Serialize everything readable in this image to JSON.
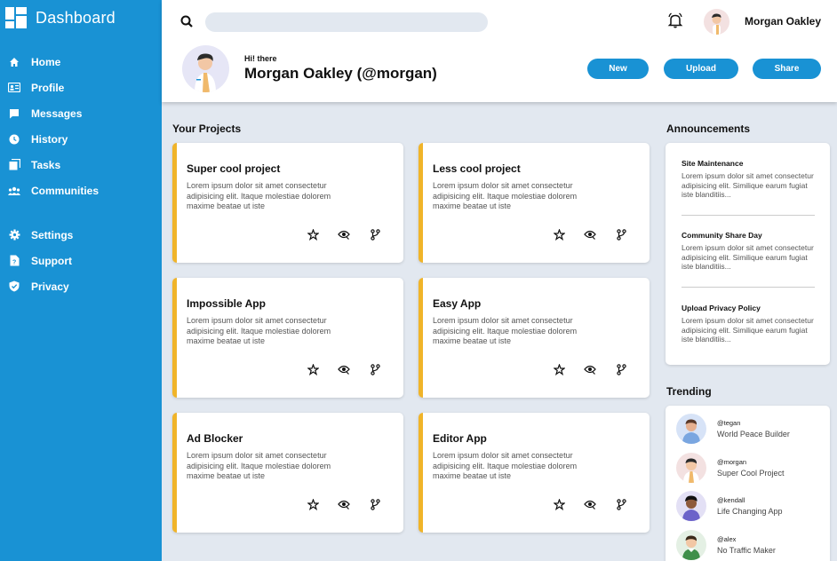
{
  "sidebar": {
    "brand": "Dashboard",
    "items": [
      {
        "label": "Home",
        "icon": "home-icon"
      },
      {
        "label": "Profile",
        "icon": "profile-card-icon"
      },
      {
        "label": "Messages",
        "icon": "message-icon"
      },
      {
        "label": "History",
        "icon": "clock-icon"
      },
      {
        "label": "Tasks",
        "icon": "tasks-icon"
      },
      {
        "label": "Communities",
        "icon": "people-icon"
      }
    ],
    "items2": [
      {
        "label": "Settings",
        "icon": "gear-icon"
      },
      {
        "label": "Support",
        "icon": "support-icon"
      },
      {
        "label": "Privacy",
        "icon": "shield-icon"
      }
    ]
  },
  "header": {
    "search_placeholder": "",
    "user_name": "Morgan Oakley",
    "greeting": "Hi! there",
    "full_name": "Morgan Oakley (@morgan)",
    "buttons": {
      "new": "New",
      "upload": "Upload",
      "share": "Share"
    }
  },
  "projects": {
    "title": "Your Projects",
    "cards": [
      {
        "title": "Super cool project",
        "desc": "Lorem ipsum dolor sit amet consectetur adipisicing elit. Itaque molestiae dolorem maxime beatae ut iste"
      },
      {
        "title": "Less cool project",
        "desc": "Lorem ipsum dolor sit amet consectetur adipisicing elit. Itaque molestiae dolorem maxime beatae ut iste"
      },
      {
        "title": "Impossible App",
        "desc": "Lorem ipsum dolor sit amet consectetur adipisicing elit. Itaque molestiae dolorem maxime beatae ut iste"
      },
      {
        "title": "Easy App",
        "desc": "Lorem ipsum dolor sit amet consectetur adipisicing elit. Itaque molestiae dolorem maxime beatae ut iste"
      },
      {
        "title": "Ad Blocker",
        "desc": "Lorem ipsum dolor sit amet consectetur adipisicing elit. Itaque molestiae dolorem maxime beatae ut iste"
      },
      {
        "title": "Editor App",
        "desc": "Lorem ipsum dolor sit amet consectetur adipisicing elit. Itaque molestiae dolorem maxime beatae ut iste"
      }
    ]
  },
  "announcements": {
    "title": "Announcements",
    "items": [
      {
        "title": "Site Maintenance",
        "desc": "Lorem ipsum dolor sit amet consectetur adipisicing elit. Similique earum fugiat iste blanditiis..."
      },
      {
        "title": "Community Share Day",
        "desc": "Lorem ipsum dolor sit amet consectetur adipisicing elit. Similique earum fugiat iste blanditiis..."
      },
      {
        "title": "Upload Privacy Policy",
        "desc": "Lorem ipsum dolor sit amet consectetur adipisicing elit. Similique earum fugiat iste blanditiis..."
      }
    ]
  },
  "trending": {
    "title": "Trending",
    "items": [
      {
        "handle": "@tegan",
        "project": "World Peace Builder"
      },
      {
        "handle": "@morgan",
        "project": "Super Cool Project"
      },
      {
        "handle": "@kendall",
        "project": "Life Changing App"
      },
      {
        "handle": "@alex",
        "project": "No Traffic Maker"
      }
    ]
  },
  "colors": {
    "sidebar": "#1992d4",
    "accent": "#f0b429",
    "background": "#e2e8f0"
  }
}
